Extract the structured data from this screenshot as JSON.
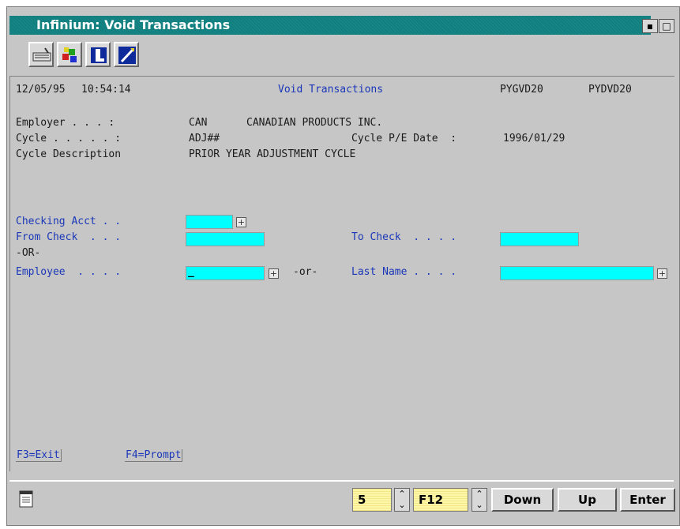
{
  "window": {
    "title": "Infinium: Void Transactions"
  },
  "header": {
    "date": "12/05/95",
    "time": "10:54:14",
    "screen_title": "Void Transactions",
    "program1": "PYGVD20",
    "program2": "PYDVD20"
  },
  "info": {
    "employer_label": "Employer . . . :",
    "employer_code": "CAN",
    "employer_name": "CANADIAN PRODUCTS INC.",
    "cycle_label": "Cycle . . . . . :",
    "cycle_value": "ADJ##",
    "cycle_pe_label": "Cycle P/E Date  :",
    "cycle_pe_value": "1996/01/29",
    "cycle_desc_label": "Cycle Description",
    "cycle_desc_value": "PRIOR YEAR ADJUSTMENT CYCLE"
  },
  "form": {
    "checking_acct_label": "Checking Acct . .",
    "from_check_label": "From Check  . . .",
    "to_check_label": "To Check  . . . .",
    "or_label": "-OR-",
    "employee_label": "Employee  . . . .",
    "or_lower": "-or-",
    "last_name_label": "Last Name . . . .",
    "checking_acct_value": "",
    "from_check_value": "",
    "to_check_value": "",
    "employee_value": "_",
    "last_name_value": ""
  },
  "fkeys": {
    "exit": "F3=Exit",
    "prompt": "F4=Prompt"
  },
  "status": {
    "page_value": "5",
    "fkey_value": "F12",
    "down": "Down",
    "up": "Up",
    "enter": "Enter"
  },
  "icons": [
    "keyboard-icon",
    "color-palette-icon",
    "info-icon",
    "edit-icon",
    "document-icon"
  ],
  "colors": {
    "titlebar": "#0f7f7f",
    "field": "#00ffff",
    "label_blue": "#1a37b8"
  }
}
